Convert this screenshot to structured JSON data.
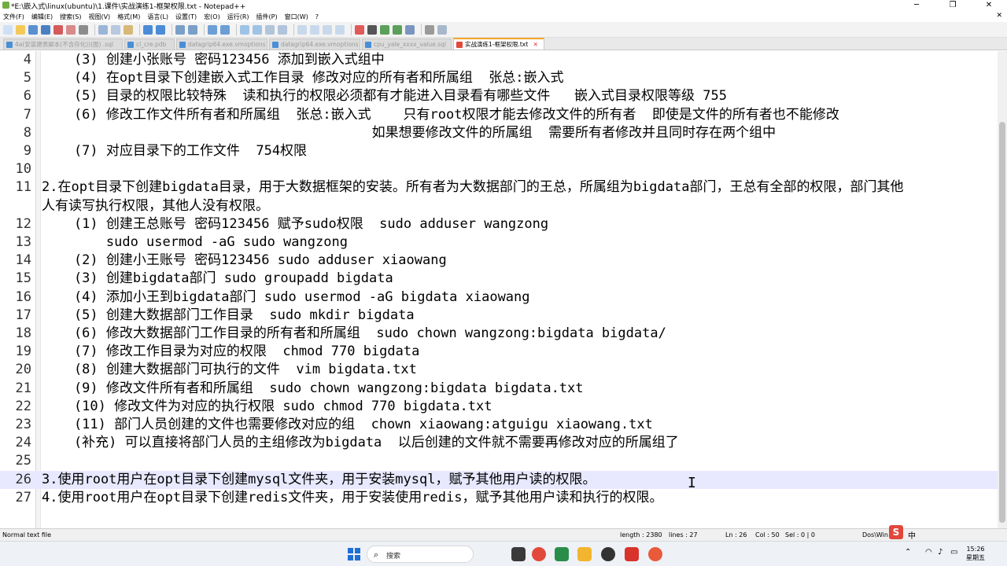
{
  "window": {
    "title": "*E:\\嵌入式\\linux(ubuntu)\\1.课件\\实战演练1-框架权限.txt - Notepad++",
    "minimize": "─",
    "maximize": "❐",
    "close": "✕"
  },
  "menu": {
    "items": [
      "文件(F)",
      "编辑(E)",
      "搜索(S)",
      "视图(V)",
      "格式(M)",
      "语言(L)",
      "设置(T)",
      "宏(O)",
      "运行(R)",
      "插件(P)",
      "窗口(W)",
      "?"
    ],
    "close": "✕"
  },
  "tabs": [
    {
      "label": "4a(安装建表脚本(不含存化))(图) .sql",
      "active": false
    },
    {
      "label": "cl_cre.pdb",
      "active": false
    },
    {
      "label": "datagrip64.exe.vmoptions",
      "active": false
    },
    {
      "label": "datagrip64.exe.vmoptions",
      "active": false
    },
    {
      "label": "cpu_yale_xxxx_value.sql",
      "active": false
    },
    {
      "label": "实战演练1-框架权限.txt",
      "active": true
    }
  ],
  "tab_close": "✕",
  "editor": {
    "current_line": 26,
    "lines": [
      {
        "n": "4",
        "text": "    (3) 创建小张账号 密码123456 添加到嵌入式组中"
      },
      {
        "n": "5",
        "text": "    (4) 在opt目录下创建嵌入式工作目录 修改对应的所有者和所属组  张总:嵌入式"
      },
      {
        "n": "6",
        "text": "    (5) 目录的权限比较特殊  读和执行的权限必须都有才能进入目录看有哪些文件   嵌入式目录权限等级 755"
      },
      {
        "n": "7",
        "text": "    (6) 修改工作文件所有者和所属组  张总:嵌入式    只有root权限才能去修改文件的所有者  即使是文件的所有者也不能修改"
      },
      {
        "n": "8",
        "text": "                                         如果想要修改文件的所属组  需要所有者修改并且同时存在两个组中"
      },
      {
        "n": "9",
        "text": "    (7) 对应目录下的工作文件  754权限"
      },
      {
        "n": "10",
        "text": ""
      },
      {
        "n": "11",
        "text": "2.在opt目录下创建bigdata目录，用于大数据框架的安装。所有者为大数据部门的王总，所属组为bigdata部门，王总有全部的权限，部门其他"
      },
      {
        "n": "",
        "text": "人有读写执行权限，其他人没有权限。"
      },
      {
        "n": "12",
        "text": "    (1) 创建王总账号 密码123456 赋予sudo权限  sudo adduser wangzong"
      },
      {
        "n": "13",
        "text": "        sudo usermod -aG sudo wangzong"
      },
      {
        "n": "14",
        "text": "    (2) 创建小王账号 密码123456 sudo adduser xiaowang"
      },
      {
        "n": "15",
        "text": "    (3) 创建bigdata部门 sudo groupadd bigdata"
      },
      {
        "n": "16",
        "text": "    (4) 添加小王到bigdata部门 sudo usermod -aG bigdata xiaowang"
      },
      {
        "n": "17",
        "text": "    (5) 创建大数据部门工作目录  sudo mkdir bigdata"
      },
      {
        "n": "18",
        "text": "    (6) 修改大数据部门工作目录的所有者和所属组  sudo chown wangzong:bigdata bigdata/"
      },
      {
        "n": "19",
        "text": "    (7) 修改工作目录为对应的权限  chmod 770 bigdata"
      },
      {
        "n": "20",
        "text": "    (8) 创建大数据部门可执行的文件  vim bigdata.txt"
      },
      {
        "n": "21",
        "text": "    (9) 修改文件所有者和所属组  sudo chown wangzong:bigdata bigdata.txt"
      },
      {
        "n": "22",
        "text": "    (10) 修改文件为对应的执行权限 sudo chmod 770 bigdata.txt"
      },
      {
        "n": "23",
        "text": "    (11) 部门人员创建的文件也需要修改对应的组  chown xiaowang:atguigu xiaowang.txt"
      },
      {
        "n": "24",
        "text": "    (补充) 可以直接将部门人员的主组修改为bigdata  以后创建的文件就不需要再修改对应的所属组了"
      },
      {
        "n": "25",
        "text": ""
      },
      {
        "n": "26",
        "text": "3.使用root用户在opt目录下创建mysql文件夹，用于安装mysql，赋予其他用户读的权限。"
      },
      {
        "n": "27",
        "text": "4.使用root用户在opt目录下创建redis文件夹，用于安装使用redis，赋予其他用户读和执行的权限。"
      }
    ]
  },
  "status": {
    "type": "Normal text file",
    "length": "length : 2380",
    "lines": "lines : 27",
    "ln": "Ln : 26",
    "col": "Col : 50",
    "sel": "Sel : 0 | 0",
    "eol": "Dos\\Win"
  },
  "ime": {
    "logo": "S",
    "lang": "中"
  },
  "taskbar": {
    "search_placeholder": "搜索",
    "time": "15:26",
    "day": "星期五"
  },
  "colors": {
    "current_line": "#e8e8ff",
    "active_tab_accent": "#f2a72a",
    "windows_blue": "#1f6fd6"
  }
}
